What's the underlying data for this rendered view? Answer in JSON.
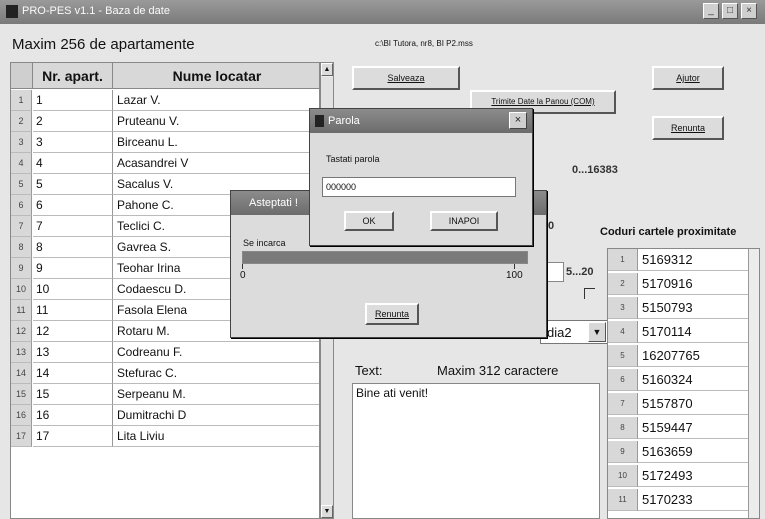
{
  "window": {
    "title": "PRO-PES v1.1 - Baza de date",
    "controls": [
      "_",
      "□",
      "×"
    ]
  },
  "header": {
    "capacity_label": "Maxim 256 de apartamente",
    "file_path": "c:\\BI Tutora, nr8, BI P2.mss"
  },
  "table": {
    "columns": [
      "Nr. apart.",
      "Nume locatar"
    ],
    "rows": [
      {
        "n": "1",
        "apart": "1",
        "name": "Lazar V."
      },
      {
        "n": "2",
        "apart": "2",
        "name": "Pruteanu V."
      },
      {
        "n": "3",
        "apart": "3",
        "name": "Birceanu L."
      },
      {
        "n": "4",
        "apart": "4",
        "name": "Acasandrei V"
      },
      {
        "n": "5",
        "apart": "5",
        "name": "Sacalus V."
      },
      {
        "n": "6",
        "apart": "6",
        "name": "Pahone C."
      },
      {
        "n": "7",
        "apart": "7",
        "name": "Teclici C."
      },
      {
        "n": "8",
        "apart": "8",
        "name": "Gavrea S."
      },
      {
        "n": "9",
        "apart": "9",
        "name": "Teohar Irina"
      },
      {
        "n": "10",
        "apart": "10",
        "name": "Codaescu D."
      },
      {
        "n": "11",
        "apart": "11",
        "name": "Fasola Elena"
      },
      {
        "n": "12",
        "apart": "12",
        "name": "Rotaru M."
      },
      {
        "n": "13",
        "apart": "13",
        "name": "Codreanu F."
      },
      {
        "n": "14",
        "apart": "14",
        "name": "Stefurac C."
      },
      {
        "n": "15",
        "apart": "15",
        "name": "Serpeanu M."
      },
      {
        "n": "16",
        "apart": "16",
        "name": "Dumitrachi D"
      },
      {
        "n": "17",
        "apart": "17",
        "name": "Lita Liviu"
      }
    ]
  },
  "buttons": {
    "save": "Salveaza",
    "send": "Trimite Date la Panou (COM)",
    "help": "Ajutor",
    "cancel_main": "Renunta"
  },
  "range_labels": {
    "code_range": "0...16383",
    "small_range": "5...20",
    "partial_value": "0",
    "combo_partial": "dia2"
  },
  "codes": {
    "title": "Coduri cartele proximitate",
    "rows": [
      {
        "n": "1",
        "code": "5169312"
      },
      {
        "n": "2",
        "code": "5170916"
      },
      {
        "n": "3",
        "code": "5150793"
      },
      {
        "n": "4",
        "code": "5170114"
      },
      {
        "n": "5",
        "code": "16207765"
      },
      {
        "n": "6",
        "code": "5160324"
      },
      {
        "n": "7",
        "code": "5157870"
      },
      {
        "n": "8",
        "code": "5159447"
      },
      {
        "n": "9",
        "code": "5163659"
      },
      {
        "n": "10",
        "code": "5172493"
      },
      {
        "n": "11",
        "code": "5170233"
      }
    ]
  },
  "text_section": {
    "label": "Text:",
    "max_label": "Maxim 312 caractere",
    "content": "Bine ati venit!"
  },
  "progress_dialog": {
    "title": "Asteptati !",
    "loading_label": "Se incarca",
    "min_label": "0",
    "max_label": "100",
    "progress": 1.0,
    "cancel": "Renunta"
  },
  "password_dialog": {
    "title": "Parola",
    "prompt": "Tastati parola",
    "value": "000000",
    "ok": "OK",
    "back": "INAPOI"
  },
  "colors": {
    "window_bg": "#e6e6e6",
    "titlebar": "#7e7e7e",
    "progress_fill": "#7a7a7a"
  }
}
